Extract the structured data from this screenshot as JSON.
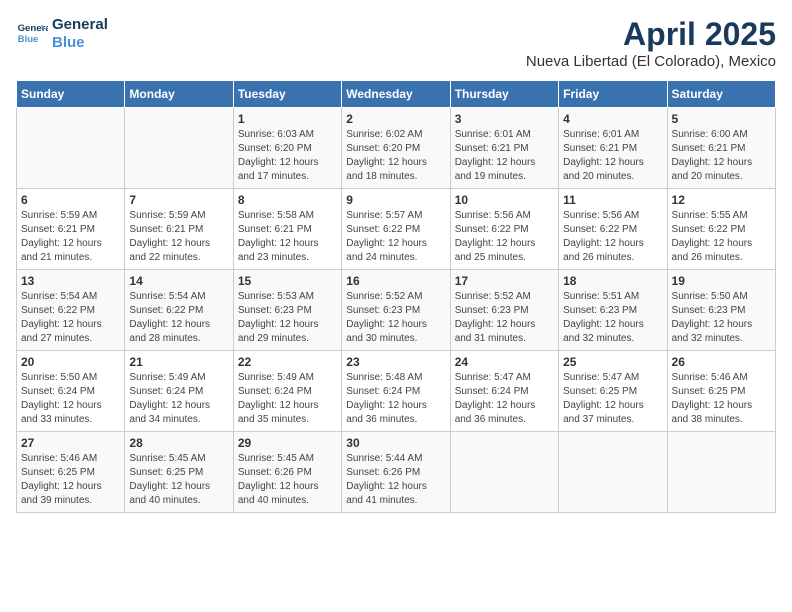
{
  "logo": {
    "line1": "General",
    "line2": "Blue"
  },
  "title": "April 2025",
  "subtitle": "Nueva Libertad (El Colorado), Mexico",
  "days_of_week": [
    "Sunday",
    "Monday",
    "Tuesday",
    "Wednesday",
    "Thursday",
    "Friday",
    "Saturday"
  ],
  "weeks": [
    [
      {
        "day": "",
        "sunrise": "",
        "sunset": "",
        "daylight": ""
      },
      {
        "day": "",
        "sunrise": "",
        "sunset": "",
        "daylight": ""
      },
      {
        "day": "1",
        "sunrise": "Sunrise: 6:03 AM",
        "sunset": "Sunset: 6:20 PM",
        "daylight": "Daylight: 12 hours and 17 minutes."
      },
      {
        "day": "2",
        "sunrise": "Sunrise: 6:02 AM",
        "sunset": "Sunset: 6:20 PM",
        "daylight": "Daylight: 12 hours and 18 minutes."
      },
      {
        "day": "3",
        "sunrise": "Sunrise: 6:01 AM",
        "sunset": "Sunset: 6:21 PM",
        "daylight": "Daylight: 12 hours and 19 minutes."
      },
      {
        "day": "4",
        "sunrise": "Sunrise: 6:01 AM",
        "sunset": "Sunset: 6:21 PM",
        "daylight": "Daylight: 12 hours and 20 minutes."
      },
      {
        "day": "5",
        "sunrise": "Sunrise: 6:00 AM",
        "sunset": "Sunset: 6:21 PM",
        "daylight": "Daylight: 12 hours and 20 minutes."
      }
    ],
    [
      {
        "day": "6",
        "sunrise": "Sunrise: 5:59 AM",
        "sunset": "Sunset: 6:21 PM",
        "daylight": "Daylight: 12 hours and 21 minutes."
      },
      {
        "day": "7",
        "sunrise": "Sunrise: 5:59 AM",
        "sunset": "Sunset: 6:21 PM",
        "daylight": "Daylight: 12 hours and 22 minutes."
      },
      {
        "day": "8",
        "sunrise": "Sunrise: 5:58 AM",
        "sunset": "Sunset: 6:21 PM",
        "daylight": "Daylight: 12 hours and 23 minutes."
      },
      {
        "day": "9",
        "sunrise": "Sunrise: 5:57 AM",
        "sunset": "Sunset: 6:22 PM",
        "daylight": "Daylight: 12 hours and 24 minutes."
      },
      {
        "day": "10",
        "sunrise": "Sunrise: 5:56 AM",
        "sunset": "Sunset: 6:22 PM",
        "daylight": "Daylight: 12 hours and 25 minutes."
      },
      {
        "day": "11",
        "sunrise": "Sunrise: 5:56 AM",
        "sunset": "Sunset: 6:22 PM",
        "daylight": "Daylight: 12 hours and 26 minutes."
      },
      {
        "day": "12",
        "sunrise": "Sunrise: 5:55 AM",
        "sunset": "Sunset: 6:22 PM",
        "daylight": "Daylight: 12 hours and 26 minutes."
      }
    ],
    [
      {
        "day": "13",
        "sunrise": "Sunrise: 5:54 AM",
        "sunset": "Sunset: 6:22 PM",
        "daylight": "Daylight: 12 hours and 27 minutes."
      },
      {
        "day": "14",
        "sunrise": "Sunrise: 5:54 AM",
        "sunset": "Sunset: 6:22 PM",
        "daylight": "Daylight: 12 hours and 28 minutes."
      },
      {
        "day": "15",
        "sunrise": "Sunrise: 5:53 AM",
        "sunset": "Sunset: 6:23 PM",
        "daylight": "Daylight: 12 hours and 29 minutes."
      },
      {
        "day": "16",
        "sunrise": "Sunrise: 5:52 AM",
        "sunset": "Sunset: 6:23 PM",
        "daylight": "Daylight: 12 hours and 30 minutes."
      },
      {
        "day": "17",
        "sunrise": "Sunrise: 5:52 AM",
        "sunset": "Sunset: 6:23 PM",
        "daylight": "Daylight: 12 hours and 31 minutes."
      },
      {
        "day": "18",
        "sunrise": "Sunrise: 5:51 AM",
        "sunset": "Sunset: 6:23 PM",
        "daylight": "Daylight: 12 hours and 32 minutes."
      },
      {
        "day": "19",
        "sunrise": "Sunrise: 5:50 AM",
        "sunset": "Sunset: 6:23 PM",
        "daylight": "Daylight: 12 hours and 32 minutes."
      }
    ],
    [
      {
        "day": "20",
        "sunrise": "Sunrise: 5:50 AM",
        "sunset": "Sunset: 6:24 PM",
        "daylight": "Daylight: 12 hours and 33 minutes."
      },
      {
        "day": "21",
        "sunrise": "Sunrise: 5:49 AM",
        "sunset": "Sunset: 6:24 PM",
        "daylight": "Daylight: 12 hours and 34 minutes."
      },
      {
        "day": "22",
        "sunrise": "Sunrise: 5:49 AM",
        "sunset": "Sunset: 6:24 PM",
        "daylight": "Daylight: 12 hours and 35 minutes."
      },
      {
        "day": "23",
        "sunrise": "Sunrise: 5:48 AM",
        "sunset": "Sunset: 6:24 PM",
        "daylight": "Daylight: 12 hours and 36 minutes."
      },
      {
        "day": "24",
        "sunrise": "Sunrise: 5:47 AM",
        "sunset": "Sunset: 6:24 PM",
        "daylight": "Daylight: 12 hours and 36 minutes."
      },
      {
        "day": "25",
        "sunrise": "Sunrise: 5:47 AM",
        "sunset": "Sunset: 6:25 PM",
        "daylight": "Daylight: 12 hours and 37 minutes."
      },
      {
        "day": "26",
        "sunrise": "Sunrise: 5:46 AM",
        "sunset": "Sunset: 6:25 PM",
        "daylight": "Daylight: 12 hours and 38 minutes."
      }
    ],
    [
      {
        "day": "27",
        "sunrise": "Sunrise: 5:46 AM",
        "sunset": "Sunset: 6:25 PM",
        "daylight": "Daylight: 12 hours and 39 minutes."
      },
      {
        "day": "28",
        "sunrise": "Sunrise: 5:45 AM",
        "sunset": "Sunset: 6:25 PM",
        "daylight": "Daylight: 12 hours and 40 minutes."
      },
      {
        "day": "29",
        "sunrise": "Sunrise: 5:45 AM",
        "sunset": "Sunset: 6:26 PM",
        "daylight": "Daylight: 12 hours and 40 minutes."
      },
      {
        "day": "30",
        "sunrise": "Sunrise: 5:44 AM",
        "sunset": "Sunset: 6:26 PM",
        "daylight": "Daylight: 12 hours and 41 minutes."
      },
      {
        "day": "",
        "sunrise": "",
        "sunset": "",
        "daylight": ""
      },
      {
        "day": "",
        "sunrise": "",
        "sunset": "",
        "daylight": ""
      },
      {
        "day": "",
        "sunrise": "",
        "sunset": "",
        "daylight": ""
      }
    ]
  ]
}
